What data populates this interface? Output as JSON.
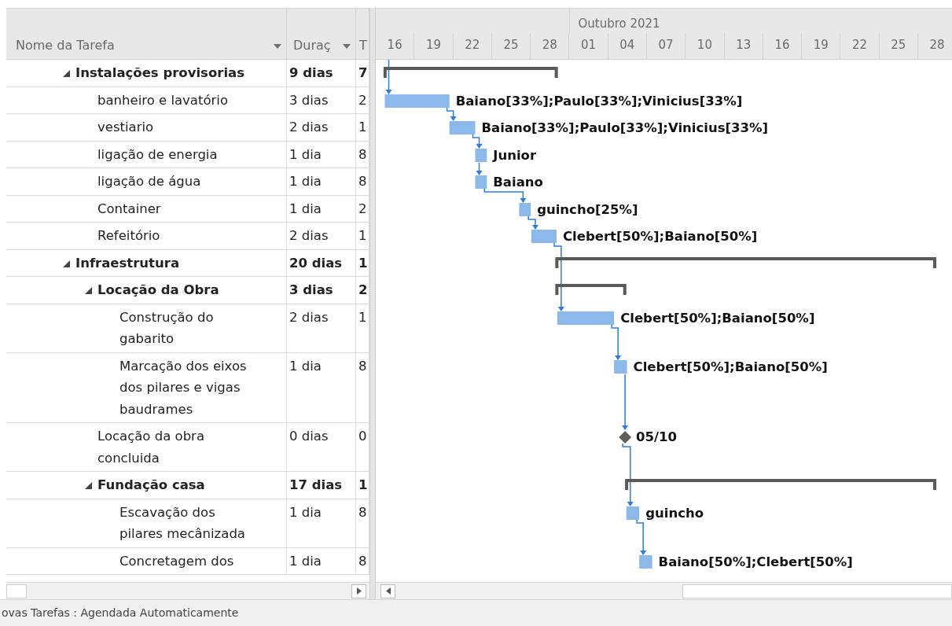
{
  "header": {
    "name_column": "Nome da Tarefa",
    "duration_column": "Duraç",
    "column_3": "T"
  },
  "timescale": {
    "month": "Outubro 2021",
    "days": [
      "16",
      "19",
      "22",
      "25",
      "28",
      "01",
      "04",
      "07",
      "10",
      "13",
      "16",
      "19",
      "22",
      "25",
      "28"
    ]
  },
  "tasks": [
    {
      "name": "Instalações provisorias",
      "duration": "9 dias",
      "column_3": "7",
      "kind": "summary",
      "expanded": true,
      "children": [
        {
          "name": "banheiro e lavatório",
          "duration": "3 dias",
          "column_3": "2",
          "kind": "task",
          "linked": true,
          "resources": "Baiano[33%];Paulo[33%];Vinicius[33%]"
        },
        {
          "name": "vestiario",
          "duration": "2 dias",
          "column_3": "1",
          "kind": "task",
          "linked": true,
          "resources": "Baiano[33%];Paulo[33%];Vinicius[33%]"
        },
        {
          "name": "ligação de energia",
          "duration": "1 dia",
          "column_3": "8",
          "kind": "task",
          "linked": true,
          "resources": "Junior"
        },
        {
          "name": "ligação de água",
          "duration": "1 dia",
          "column_3": "8",
          "kind": "task",
          "linked": true,
          "resources": "Baiano"
        },
        {
          "name": "Container",
          "duration": "1 dia",
          "column_3": "2",
          "kind": "task",
          "linked": true,
          "resources": "guincho[25%]"
        },
        {
          "name": "Refeitório",
          "duration": "2 dias",
          "column_3": "1",
          "kind": "task",
          "linked": true,
          "resources": "Clebert[50%];Baiano[50%]"
        }
      ]
    },
    {
      "name": "Infraestrutura",
      "duration": "20 dias",
      "column_3": "1",
      "kind": "summary",
      "expanded": true,
      "children": [
        {
          "name": "Locação da Obra",
          "duration": "3 dias",
          "column_3": "2",
          "kind": "summary",
          "expanded": true,
          "children": [
            {
              "name": "Construção do gabarito",
              "duration": "2 dias",
              "column_3": "1",
              "kind": "task",
              "linked": true,
              "resources": "Clebert[50%];Baiano[50%]"
            },
            {
              "name": "Marcação dos eixos dos pilares e vigas baudrames",
              "duration": "1 dia",
              "column_3": "8",
              "kind": "task",
              "linked": true,
              "resources": "Clebert[50%];Baiano[50%]"
            }
          ]
        },
        {
          "name": "Locação da obra concluida",
          "duration": "0 dias",
          "column_3": "0",
          "kind": "milestone",
          "linked": true,
          "resources": "05/10"
        },
        {
          "name": "Fundação casa",
          "duration": "17 dias",
          "column_3": "1",
          "kind": "summary",
          "expanded": true,
          "children": [
            {
              "name": "Escavação dos pilares mecânizada",
              "duration": "1 dia",
              "column_3": "8",
              "kind": "task",
              "linked": true,
              "resources": "guincho"
            },
            {
              "name": "Concretagem dos",
              "duration": "1 dia",
              "column_3": "8",
              "kind": "task",
              "linked": true,
              "resources": "Baiano[50%];Clebert[50%]"
            }
          ]
        }
      ]
    }
  ],
  "status_bar": {
    "text": "ovas Tarefas : Agendada Automaticamente"
  }
}
